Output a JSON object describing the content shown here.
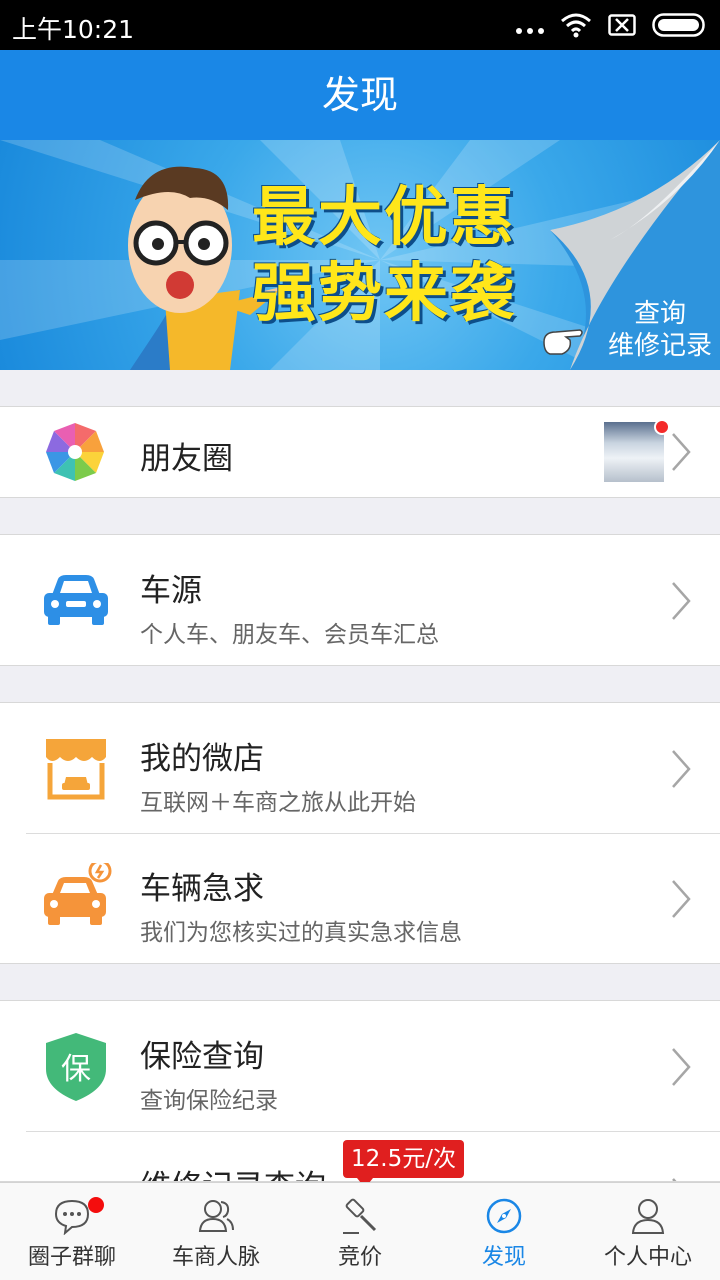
{
  "status_bar": {
    "time": "上午10:21"
  },
  "header": {
    "title": "发现"
  },
  "banner": {
    "headline_line1": "最大优惠",
    "headline_line2": "强势来袭",
    "link_line1": "查询",
    "link_line2": "维修记录"
  },
  "sections": {
    "moments": {
      "label": "朋友圈"
    },
    "car_source": {
      "label": "车源",
      "sub": "个人车、朋友车、会员车汇总"
    },
    "microstore": {
      "label": "我的微店",
      "sub": "互联网＋车商之旅从此开始"
    },
    "urgent": {
      "label": "车辆急求",
      "sub": "我们为您核实过的真实急求信息"
    },
    "insurance": {
      "label": "保险查询",
      "sub": "查询保险纪录",
      "icon_char": "保"
    },
    "repair": {
      "label": "维修记录查询",
      "price": "12.5元/次"
    }
  },
  "tabbar": {
    "tabs": [
      {
        "label": "圈子群聊",
        "icon": "chat-icon"
      },
      {
        "label": "车商人脉",
        "icon": "contacts-icon"
      },
      {
        "label": "竞价",
        "icon": "gavel-icon"
      },
      {
        "label": "发现",
        "icon": "compass-icon",
        "active": true
      },
      {
        "label": "个人中心",
        "icon": "person-icon"
      }
    ]
  },
  "colors": {
    "primary": "#1a87e6",
    "orange": "#f5a53a",
    "green": "#43b979",
    "badge_red": "#f40d0d"
  }
}
